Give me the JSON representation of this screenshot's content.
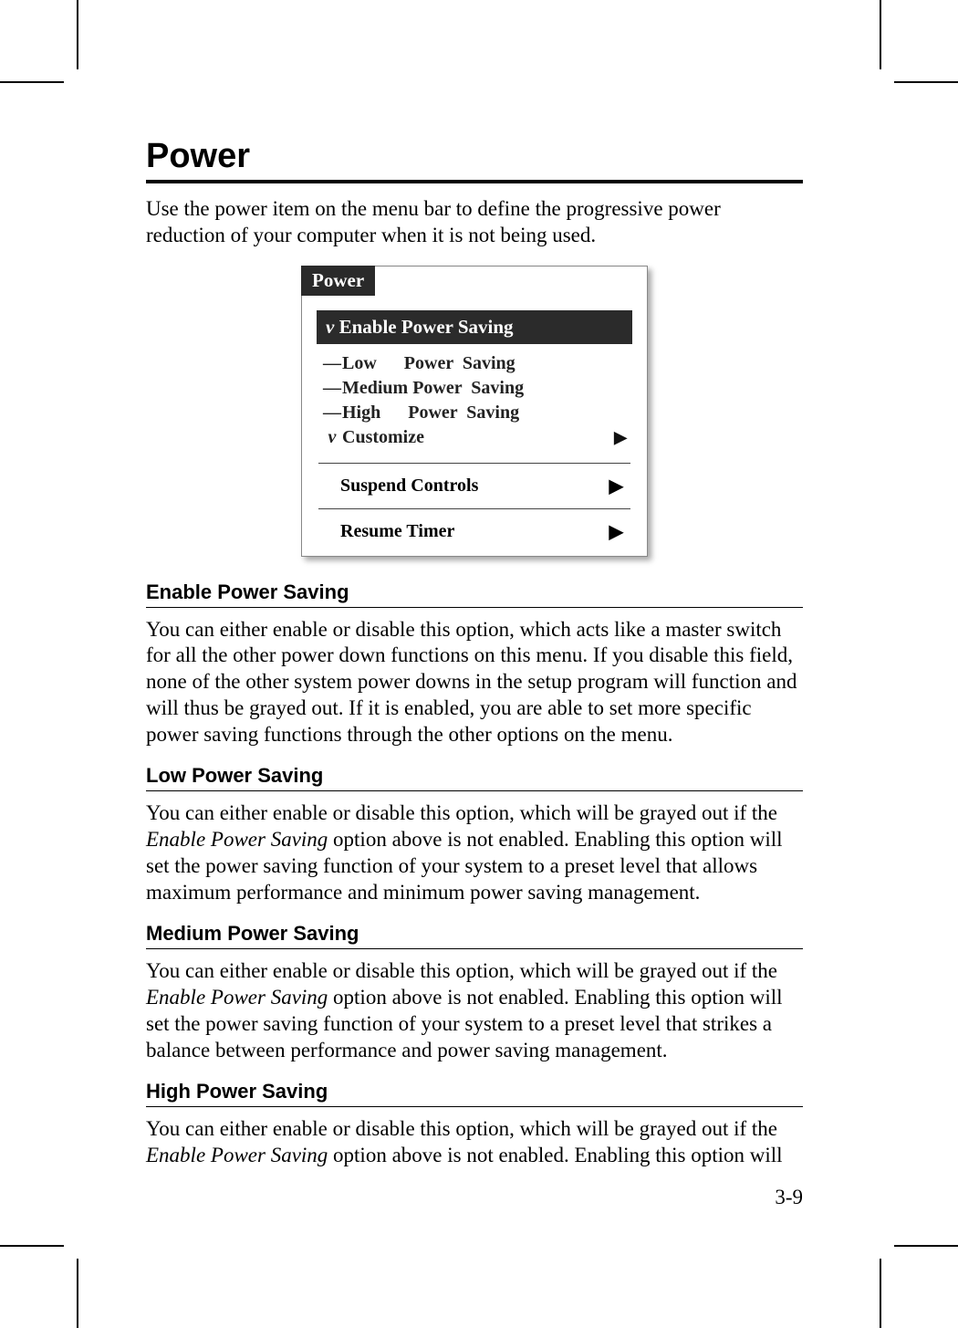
{
  "title": "Power",
  "intro": "Use the power item on the menu bar to define the progressive power reduction of your computer when it is not being used.",
  "menu": {
    "tab": "Power",
    "header_prefix": "ν",
    "header": "Enable Power Saving",
    "items": [
      {
        "prefix": "—",
        "label": "Low      Power  Saving",
        "arrow": ""
      },
      {
        "prefix": "—",
        "label": "Medium Power  Saving",
        "arrow": ""
      },
      {
        "prefix": "—",
        "label": "High      Power  Saving",
        "arrow": ""
      },
      {
        "prefix": "ν",
        "label": "Customize",
        "arrow": "▶"
      }
    ],
    "sub1": {
      "label": "Suspend Controls",
      "arrow": "▶"
    },
    "sub2": {
      "label": "Resume Timer",
      "arrow": "▶"
    }
  },
  "sections": [
    {
      "heading": "Enable Power Saving",
      "text_plain": "You can either enable or disable this option, which acts like a master switch for all the other power down functions on this menu. If you disable this field, none of the other system power downs in the setup program will function and will thus be grayed out. If it is enabled, you are able to set more specific power saving functions through the other options on the menu."
    },
    {
      "heading": "Low Power Saving",
      "text_before": "You can either enable or disable this option, which will be grayed out if the ",
      "italic": "Enable Power Saving",
      "text_after": " option above is not enabled. Enabling this option will set the power saving function of your system to a preset level that allows maximum performance and minimum power saving management."
    },
    {
      "heading": "Medium Power Saving",
      "text_before": "You can either enable or disable this option, which will be grayed out if the ",
      "italic": "Enable Power Saving",
      "text_after": " option above is not enabled. Enabling this option will set the power saving function of your system to a preset level that strikes a balance between performance and power saving management."
    },
    {
      "heading": "High Power Saving",
      "text_before": "You can either enable or disable this option, which will be grayed out if the ",
      "italic": "Enable Power Saving",
      "text_after": " option above is not enabled. Enabling this option will"
    }
  ],
  "page_number": "3-9"
}
